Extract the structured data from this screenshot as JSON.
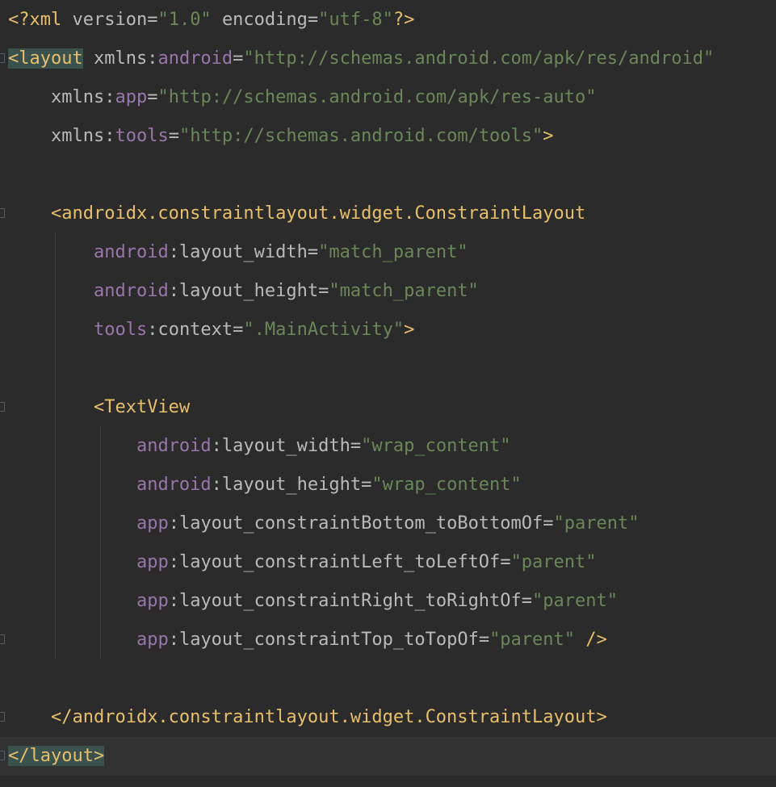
{
  "colors": {
    "background": "#2b2b2b",
    "current_line": "#323232",
    "tag": "#e8bf6a",
    "namespace": "#9876aa",
    "attribute": "#bababa",
    "string": "#6a8759",
    "match_highlight": "#3b514d"
  },
  "lines": [
    [
      {
        "t": "<?xml ",
        "c": "t-punct"
      },
      {
        "t": "version",
        "c": "t-attr"
      },
      {
        "t": "=",
        "c": "t-eq"
      },
      {
        "t": "\"1.0\"",
        "c": "t-val"
      },
      {
        "t": " ",
        "c": "t-plain"
      },
      {
        "t": "encoding",
        "c": "t-attr"
      },
      {
        "t": "=",
        "c": "t-eq"
      },
      {
        "t": "\"utf-8\"",
        "c": "t-val"
      },
      {
        "t": "?>",
        "c": "t-punct"
      }
    ],
    [
      {
        "t": "<layout",
        "c": "t-tag",
        "hl": true
      },
      {
        "t": " ",
        "c": "t-plain"
      },
      {
        "t": "xmlns",
        "c": "t-attr"
      },
      {
        "t": ":",
        "c": "t-attr"
      },
      {
        "t": "android",
        "c": "t-attrns"
      },
      {
        "t": "=",
        "c": "t-eq"
      },
      {
        "t": "\"http://schemas.android.com/apk/res/android\"",
        "c": "t-val"
      }
    ],
    [
      {
        "t": "    ",
        "c": "t-plain"
      },
      {
        "t": "xmlns",
        "c": "t-attr"
      },
      {
        "t": ":",
        "c": "t-attr"
      },
      {
        "t": "app",
        "c": "t-attrns"
      },
      {
        "t": "=",
        "c": "t-eq"
      },
      {
        "t": "\"http://schemas.android.com/apk/res-auto\"",
        "c": "t-val"
      }
    ],
    [
      {
        "t": "    ",
        "c": "t-plain"
      },
      {
        "t": "xmlns",
        "c": "t-attr"
      },
      {
        "t": ":",
        "c": "t-attr"
      },
      {
        "t": "tools",
        "c": "t-attrns"
      },
      {
        "t": "=",
        "c": "t-eq"
      },
      {
        "t": "\"http://schemas.android.com/tools\"",
        "c": "t-val"
      },
      {
        "t": ">",
        "c": "t-tag"
      }
    ],
    [],
    [
      {
        "t": "    ",
        "c": "t-plain"
      },
      {
        "t": "<androidx.constraintlayout.widget.ConstraintLayout",
        "c": "t-tag"
      }
    ],
    [
      {
        "t": "        ",
        "c": "t-plain"
      },
      {
        "t": "android",
        "c": "t-attrns"
      },
      {
        "t": ":layout_width",
        "c": "t-attr"
      },
      {
        "t": "=",
        "c": "t-eq"
      },
      {
        "t": "\"match_parent\"",
        "c": "t-val"
      }
    ],
    [
      {
        "t": "        ",
        "c": "t-plain"
      },
      {
        "t": "android",
        "c": "t-attrns"
      },
      {
        "t": ":layout_height",
        "c": "t-attr"
      },
      {
        "t": "=",
        "c": "t-eq"
      },
      {
        "t": "\"match_parent\"",
        "c": "t-val"
      }
    ],
    [
      {
        "t": "        ",
        "c": "t-plain"
      },
      {
        "t": "tools",
        "c": "t-attrns"
      },
      {
        "t": ":context",
        "c": "t-attr"
      },
      {
        "t": "=",
        "c": "t-eq"
      },
      {
        "t": "\".MainActivity\"",
        "c": "t-val"
      },
      {
        "t": ">",
        "c": "t-tag"
      }
    ],
    [],
    [
      {
        "t": "        ",
        "c": "t-plain"
      },
      {
        "t": "<TextView",
        "c": "t-tag"
      }
    ],
    [
      {
        "t": "            ",
        "c": "t-plain"
      },
      {
        "t": "android",
        "c": "t-attrns"
      },
      {
        "t": ":layout_width",
        "c": "t-attr"
      },
      {
        "t": "=",
        "c": "t-eq"
      },
      {
        "t": "\"wrap_content\"",
        "c": "t-val"
      }
    ],
    [
      {
        "t": "            ",
        "c": "t-plain"
      },
      {
        "t": "android",
        "c": "t-attrns"
      },
      {
        "t": ":layout_height",
        "c": "t-attr"
      },
      {
        "t": "=",
        "c": "t-eq"
      },
      {
        "t": "\"wrap_content\"",
        "c": "t-val"
      }
    ],
    [
      {
        "t": "            ",
        "c": "t-plain"
      },
      {
        "t": "app",
        "c": "t-attrns"
      },
      {
        "t": ":layout_constraintBottom_toBottomOf",
        "c": "t-attr"
      },
      {
        "t": "=",
        "c": "t-eq"
      },
      {
        "t": "\"parent\"",
        "c": "t-val"
      }
    ],
    [
      {
        "t": "            ",
        "c": "t-plain"
      },
      {
        "t": "app",
        "c": "t-attrns"
      },
      {
        "t": ":layout_constraintLeft_toLeftOf",
        "c": "t-attr"
      },
      {
        "t": "=",
        "c": "t-eq"
      },
      {
        "t": "\"parent\"",
        "c": "t-val"
      }
    ],
    [
      {
        "t": "            ",
        "c": "t-plain"
      },
      {
        "t": "app",
        "c": "t-attrns"
      },
      {
        "t": ":layout_constraintRight_toRightOf",
        "c": "t-attr"
      },
      {
        "t": "=",
        "c": "t-eq"
      },
      {
        "t": "\"parent\"",
        "c": "t-val"
      }
    ],
    [
      {
        "t": "            ",
        "c": "t-plain"
      },
      {
        "t": "app",
        "c": "t-attrns"
      },
      {
        "t": ":layout_constraintTop_toTopOf",
        "c": "t-attr"
      },
      {
        "t": "=",
        "c": "t-eq"
      },
      {
        "t": "\"parent\"",
        "c": "t-val"
      },
      {
        "t": " ",
        "c": "t-plain"
      },
      {
        "t": "/>",
        "c": "t-tag"
      }
    ],
    [],
    [
      {
        "t": "    ",
        "c": "t-plain"
      },
      {
        "t": "</androidx.constraintlayout.widget.ConstraintLayout>",
        "c": "t-tag"
      }
    ],
    [
      {
        "t": "</layout>",
        "c": "t-tag",
        "hl": true
      }
    ]
  ]
}
